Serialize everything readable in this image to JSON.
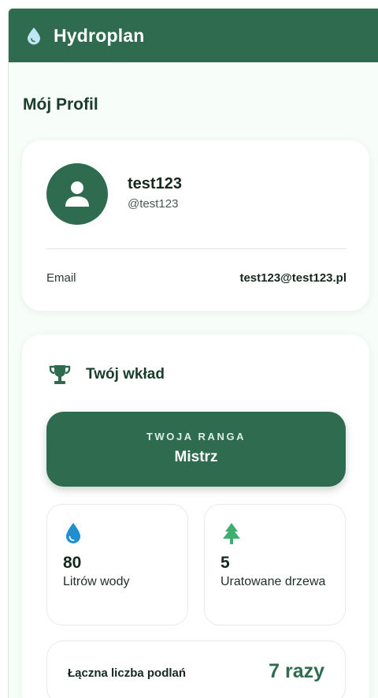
{
  "app": {
    "title": "Hydroplan",
    "logo_icon": "water-drop-icon"
  },
  "page": {
    "title": "Mój Profil"
  },
  "profile": {
    "avatar_icon": "user-icon",
    "username": "test123",
    "handle": "@test123",
    "email_label": "Email",
    "email_value": "test123@test123.pl"
  },
  "contribution": {
    "title": "Twój wkład",
    "icon": "trophy-icon",
    "rank_label": "TWOJA RANGA",
    "rank_value": "Mistrz",
    "stats": [
      {
        "icon": "water-drop-icon",
        "value": "80",
        "label": "Litrów wody"
      },
      {
        "icon": "tree-icon",
        "value": "5",
        "label": "Uratowane drzewa"
      }
    ],
    "total_label": "Łączna liczba podlań",
    "total_value": "7 razy"
  },
  "colors": {
    "primary": "#2e6b4f",
    "background": "#f7fdf8",
    "water": "#1f8fd1",
    "tree": "#3fae6e"
  }
}
